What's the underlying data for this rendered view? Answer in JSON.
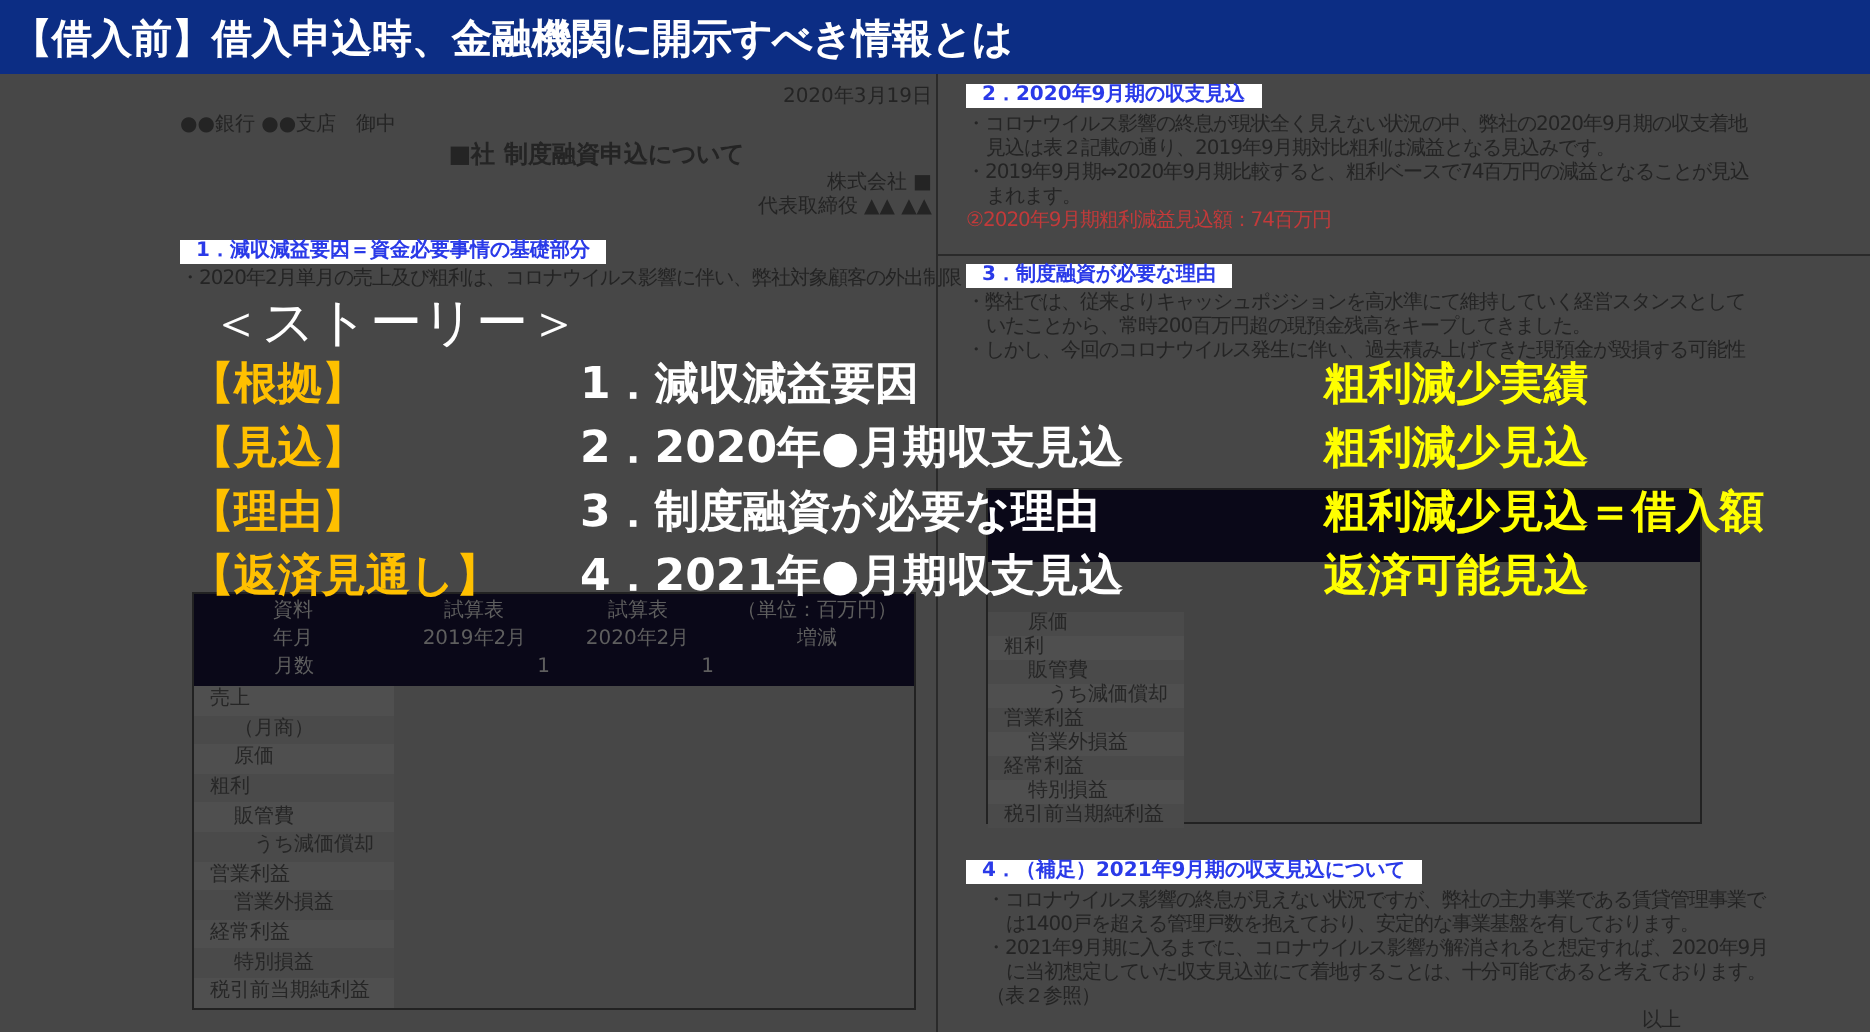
{
  "header": {
    "title": "【借入前】借入申込時、金融機関に開示すべき情報とは"
  },
  "document": {
    "date": "2020年3月19日",
    "addressee": "●●銀行 ●●支店　御中",
    "title": "■社 制度融資申込について",
    "company": "株式会社 ■",
    "representative": "代表取締役 ▲▲ ▲▲",
    "section_1": {
      "heading": "1．減収減益要因＝資金必要事情の基礎部分",
      "lines": [
        {
          "kind": "bullet",
          "text": "・2020年2月単月の売上及び粗利は、コロナウイルス影響に伴い、弊社対象顧客の外出制限"
        }
      ]
    },
    "table_1": {
      "header_rows": [
        {
          "kind": "text",
          "cells": [
            "資料",
            "試算表",
            "試算表",
            "（単位：百万円）"
          ]
        },
        {
          "kind": "text",
          "cells": [
            "年月",
            "2019年2月",
            "2020年2月",
            "増減"
          ]
        },
        {
          "kind": "count",
          "cells": [
            "月数",
            "1",
            "1"
          ]
        }
      ],
      "rows": [
        {
          "label": "売上",
          "children": [
            {
              "label": "（月商）"
            },
            {
              "label": "原価"
            }
          ]
        },
        {
          "label": "粗利",
          "children": [
            {
              "label": "販管費",
              "children": [
                {
                  "label": "うち減価償却"
                }
              ]
            }
          ]
        },
        {
          "label": "営業利益",
          "children": [
            {
              "label": "営業外損益"
            }
          ]
        },
        {
          "label": "経常利益",
          "children": [
            {
              "label": "特別損益"
            }
          ]
        },
        {
          "label": "税引前当期純利益"
        }
      ]
    },
    "section_2": {
      "heading": "2．2020年9月期の収支見込",
      "lines": [
        {
          "kind": "bullet",
          "text": "・コロナウイルス影響の終息が現状全く見えない状況の中、弊社の2020年9月期の収支着地"
        },
        {
          "kind": "cont",
          "text": "見込は表２記載の通り、2019年9月期対比粗利は減益となる見込みです。"
        },
        {
          "kind": "bullet",
          "text": "・2019年9月期⇔2020年9月期比較すると、粗利ベースで74百万円の減益となることが見込"
        },
        {
          "kind": "cont",
          "text": "まれます。"
        },
        {
          "kind": "note",
          "text": "②2020年9月期粗利減益見込額：74百万円"
        }
      ]
    },
    "section_3": {
      "heading": "3．制度融資が必要な理由",
      "lines": [
        {
          "kind": "bullet",
          "text": "・弊社では、従来よりキャッシュポジションを高水準にて維持していく経営スタンスとして"
        },
        {
          "kind": "cont",
          "text": "いたことから、常時200百万円超の現預金残高をキープしてきました。"
        },
        {
          "kind": "bullet",
          "text": "・しかし、今回のコロナウイルス発生に伴い、過去積み上げてきた現預金が毀損する可能性"
        }
      ]
    },
    "table_2": {
      "rows": [
        {
          "children": [
            {
              "label": "原価"
            }
          ]
        },
        {
          "label": "粗利",
          "children": [
            {
              "label": "販管費",
              "children": [
                {
                  "label": "うち減価償却"
                }
              ]
            }
          ]
        },
        {
          "label": "営業利益",
          "children": [
            {
              "label": "営業外損益"
            }
          ]
        },
        {
          "label": "経常利益",
          "children": [
            {
              "label": "特別損益"
            }
          ]
        },
        {
          "label": "税引前当期純利益"
        }
      ]
    },
    "section_4": {
      "heading": "4．（補足）2021年9月期の収支見込について",
      "lines": [
        {
          "kind": "bullet",
          "text": "・コロナウイルス影響の終息が見えない状況ですが、弊社の主力事業である賃貸管理事業で"
        },
        {
          "kind": "cont",
          "text": "は1400戸を超える管理戸数を抱えており、安定的な事業基盤を有しております。"
        },
        {
          "kind": "bullet",
          "text": "・2021年9月期に入るまでに、コロナウイルス影響が解消されると想定すれば、2020年9月"
        },
        {
          "kind": "cont",
          "text": "に当初想定していた収支見込並にて着地することは、十分可能であると考えております。"
        },
        {
          "kind": "bullet",
          "text": "（表２参照）"
        },
        {
          "kind": "closing",
          "text": "以上"
        }
      ]
    }
  },
  "story": {
    "heading": "＜ストーリー＞",
    "rows": [
      {
        "label": "【根拠】",
        "item": "1．減収減益要因",
        "result": "粗利減少実績"
      },
      {
        "label": "【見込】",
        "item": "2．2020年●月期収支見込",
        "result": "粗利減少見込"
      },
      {
        "label": "【理由】",
        "item": "3．制度融資が必要な理由",
        "result": "粗利減少見込＝借入額"
      },
      {
        "label": "【返済見通し】",
        "item": "4．2021年●月期収支見込",
        "result": "返済可能見込"
      }
    ]
  }
}
